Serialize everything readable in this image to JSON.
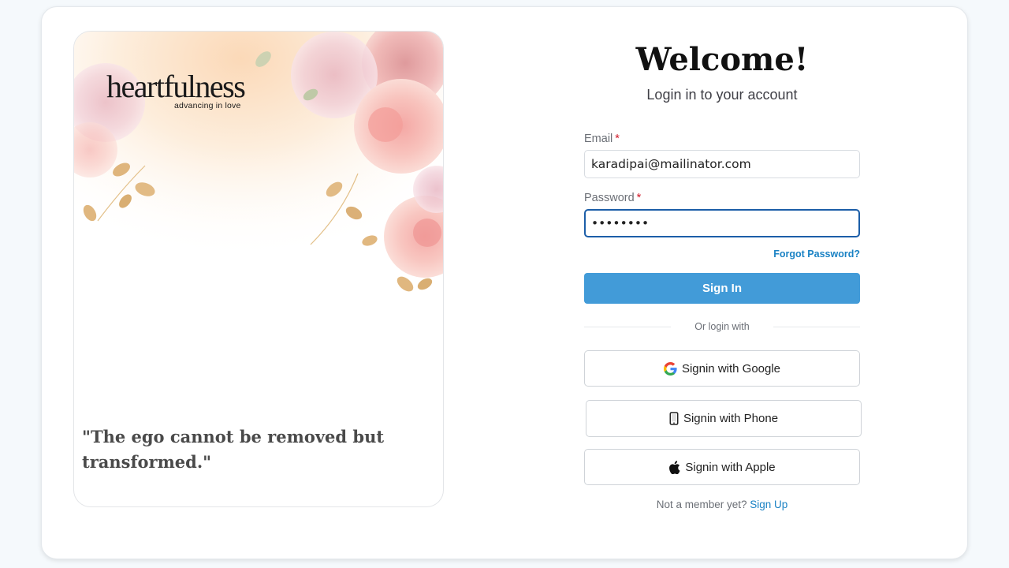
{
  "brand": {
    "logo_word": "heartfulness",
    "logo_tagline": "advancing in love"
  },
  "hero": {
    "quote": "\"The ego cannot be removed but transformed.\""
  },
  "login": {
    "title": "Welcome!",
    "subtitle": "Login in to your account",
    "email_label": "Email",
    "email_value": "karadipai@mailinator.com",
    "password_label": "Password",
    "password_masked": "••••••••",
    "required_marker": "*",
    "forgot_password": "Forgot Password?",
    "signin_button": "Sign In",
    "divider_text": "Or login with",
    "social": {
      "google": "Signin with Google",
      "phone": "Signin with Phone",
      "apple": "Signin with Apple"
    },
    "signup_prompt": "Not a member yet?",
    "signup_link": "Sign Up"
  },
  "colors": {
    "accent_blue": "#429bd8",
    "link_blue": "#1a82c4",
    "required_red": "#d11a2a",
    "focus_border": "#1c5ea8"
  },
  "icons": {
    "google": "google-g-icon",
    "phone": "mobile-phone-icon",
    "apple": "apple-logo-icon"
  }
}
